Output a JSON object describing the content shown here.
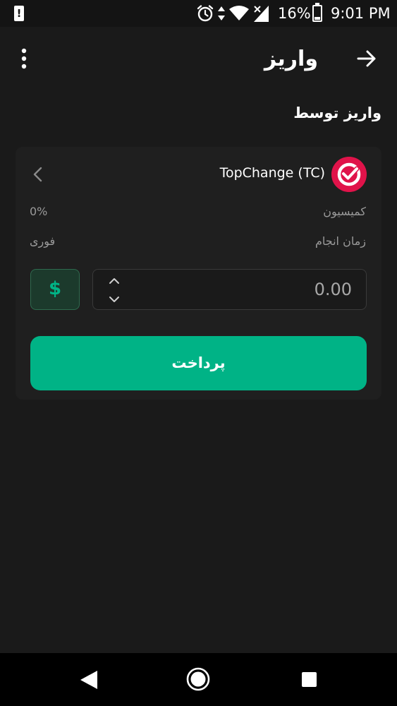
{
  "status_bar": {
    "alert_glyph": "!",
    "battery": "16%",
    "time": "9:01 PM",
    "icons": [
      "alarm-icon",
      "data-arrows-icon",
      "wifi-icon",
      "signal-icon",
      "battery-icon"
    ]
  },
  "header": {
    "title": "واریز",
    "menu_icon": "more-vert-icon",
    "back_icon": "arrow-forward-icon"
  },
  "section_title": "واریز توسط",
  "provider": {
    "name": "TopChange (TC)",
    "logo_color": "#e0134a",
    "commission_label": "کمیسیون",
    "commission_value": "0%",
    "time_label": "زمان انجام",
    "time_value": "فوری"
  },
  "amount": {
    "currency_symbol": "$",
    "placeholder": "0.00"
  },
  "pay_button": "پرداخت",
  "colors": {
    "accent": "#00b386",
    "background": "#1a1a1a",
    "card": "#1f1f1f"
  }
}
